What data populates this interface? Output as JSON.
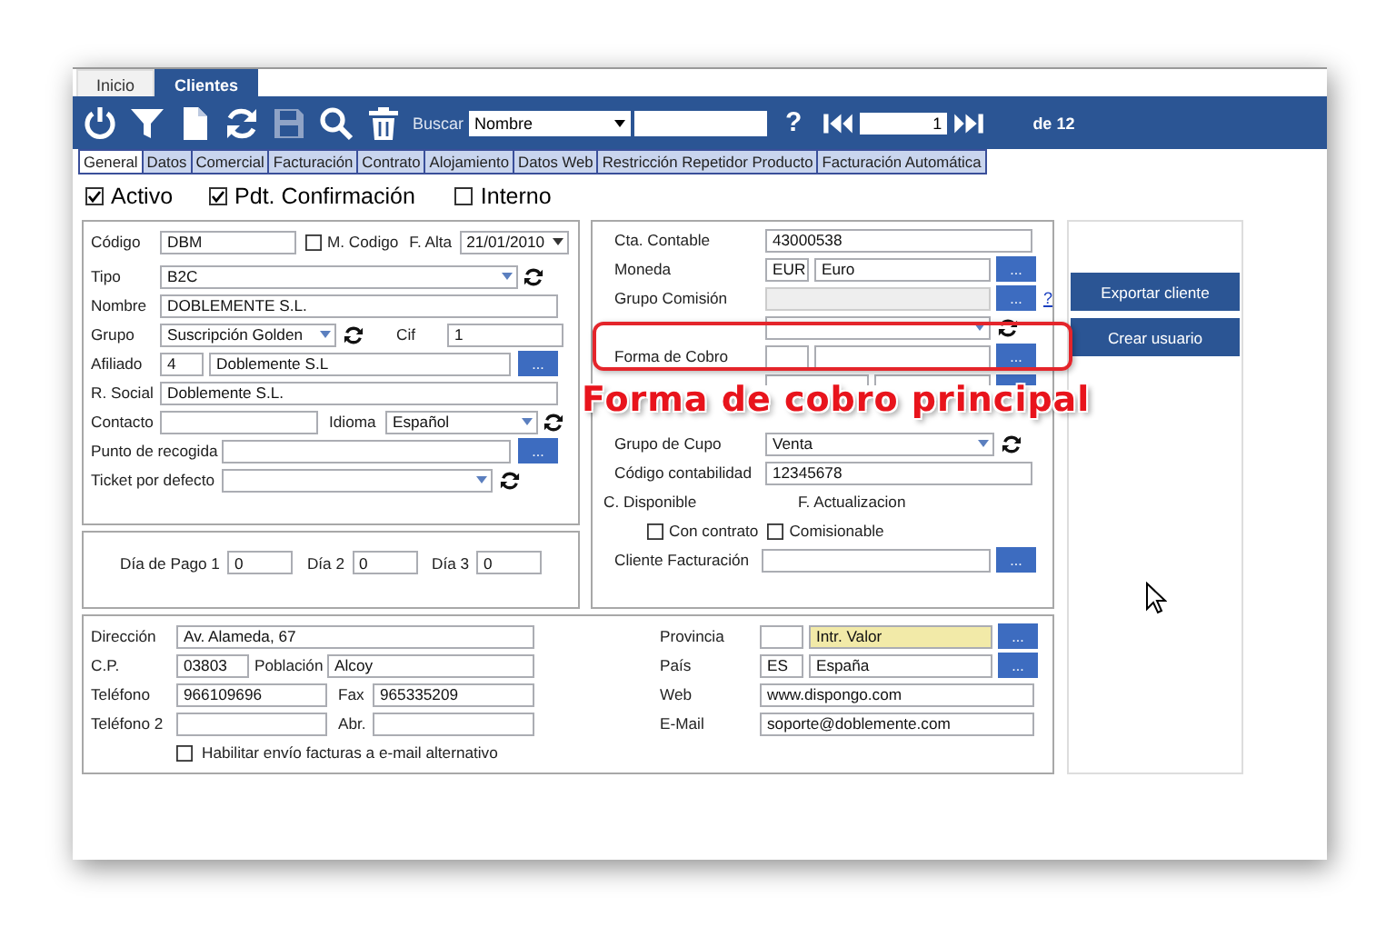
{
  "app_tabs": [
    {
      "label": "Inicio",
      "selected": false
    },
    {
      "label": "Clientes",
      "selected": true
    }
  ],
  "toolbar": {
    "search_label": "Buscar",
    "search_field": "Nombre",
    "help": "?",
    "record": "1",
    "record_total": "de 12"
  },
  "tabs": [
    {
      "label": "General",
      "selected": true
    },
    {
      "label": "Datos",
      "selected": false
    },
    {
      "label": "Comercial",
      "selected": false
    },
    {
      "label": "Facturación",
      "selected": false
    },
    {
      "label": "Contrato",
      "selected": false
    },
    {
      "label": "Alojamiento",
      "selected": false
    },
    {
      "label": "Datos Web",
      "selected": false
    },
    {
      "label": "Restricción Repetidor Producto",
      "selected": false
    },
    {
      "label": "Facturación Automática",
      "selected": false
    }
  ],
  "flags": [
    {
      "label": "Activo",
      "checked": true
    },
    {
      "label": "Pdt. Confirmación",
      "checked": true
    },
    {
      "label": "Interno",
      "checked": false
    }
  ],
  "general": {
    "codigo": {
      "label": "Código",
      "value": "DBM"
    },
    "m_codigo": {
      "label": "M. Codigo",
      "checked": false
    },
    "f_alta": {
      "label": "F. Alta",
      "value": "21/01/2010"
    },
    "tipo": {
      "label": "Tipo",
      "value": "B2C"
    },
    "nombre": {
      "label": "Nombre",
      "value": "DOBLEMENTE S.L."
    },
    "grupo": {
      "label": "Grupo",
      "value": "Suscripción Golden"
    },
    "cif": {
      "label": "Cif",
      "value": "1"
    },
    "afiliado": {
      "label": "Afiliado",
      "code": "4",
      "value": "Doblemente S.L",
      "button": "..."
    },
    "r_social": {
      "label": "R. Social",
      "value": "Doblemente S.L."
    },
    "contacto": {
      "label": "Contacto"
    },
    "idioma": {
      "label": "Idioma",
      "value": "Español"
    },
    "punto": {
      "label": "Punto de recogida",
      "button": "..."
    },
    "ticket": {
      "label": "Ticket por defecto"
    }
  },
  "pay_days": [
    {
      "label": "Día de Pago 1",
      "value": "0"
    },
    {
      "label": "Día 2",
      "value": "0"
    },
    {
      "label": "Día 3",
      "value": "0"
    }
  ],
  "accounting": {
    "cta": {
      "label": "Cta. Contable",
      "value": "43000538"
    },
    "moneda": {
      "label": "Moneda",
      "code": "EUR",
      "value": "Euro",
      "button": "..."
    },
    "grupo_comision": {
      "label": "Grupo Comisión",
      "disabled": true,
      "button": "...",
      "help": "?"
    },
    "forma_cobro": {
      "label": "Forma de Cobro",
      "button": "..."
    },
    "grupo_cupo": {
      "label": "Grupo de Cupo",
      "value": "Venta"
    },
    "codigo_contab": {
      "label": "Código contabilidad",
      "value": "12345678"
    },
    "disponible": {
      "label": "C. Disponible"
    },
    "actualizacion": {
      "label": "F. Actualizacion"
    },
    "options": [
      {
        "label": "Con contrato",
        "checked": false
      },
      {
        "label": "Comisionable",
        "checked": false
      }
    ],
    "cliente_fact": {
      "label": "Cliente Facturación",
      "button": "..."
    }
  },
  "buttons": [
    "Exportar cliente",
    "Crear usuario"
  ],
  "address": {
    "direccion": {
      "label": "Dirección",
      "value": "Av. Alameda, 67"
    },
    "cp": {
      "label": "C.P.",
      "value": "03803"
    },
    "poblacion": {
      "label": "Población",
      "value": "Alcoy"
    },
    "telefono": {
      "label": "Teléfono",
      "value": "966109696"
    },
    "fax": {
      "label": "Fax",
      "value": "965335209"
    },
    "telefono2": {
      "label": "Teléfono 2"
    },
    "abr": {
      "label": "Abr."
    },
    "alt_email": {
      "label": "Habilitar envío facturas a e-mail alternativo",
      "checked": false
    },
    "provincia": {
      "label": "Provincia",
      "value": "Intr. Valor",
      "highlighted": true,
      "button": "..."
    },
    "pais": {
      "label": "País",
      "code": "ES",
      "value": "España",
      "highlighted": false,
      "button": "..."
    },
    "web": {
      "label": "Web",
      "value": "www.dispongo.com"
    },
    "email": {
      "label": "E-Mail",
      "value": "soporte@doblemente.com"
    }
  },
  "annotation": "Forma de cobro principal"
}
